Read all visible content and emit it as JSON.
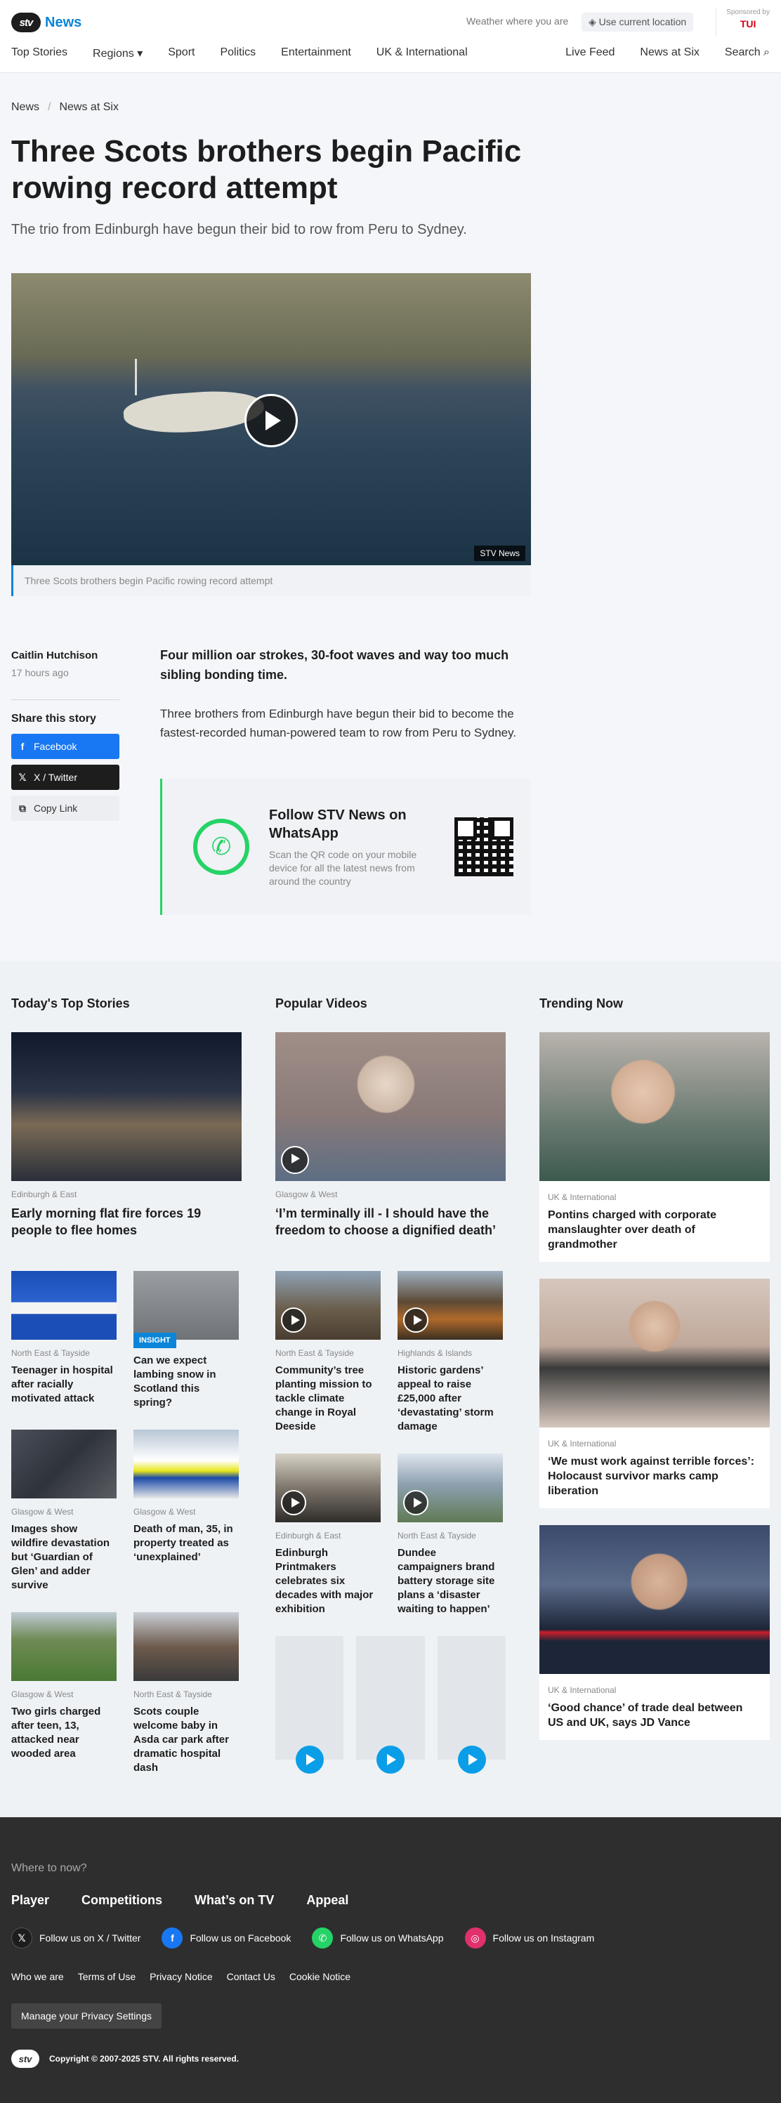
{
  "header": {
    "logo_mark": "stv",
    "logo_news": "News",
    "weather_text": "Weather where you are",
    "location_button": "Use current location",
    "sponsor_text": "Sponsored by",
    "sponsor_brand": "TUI",
    "nav_left": [
      "Top Stories",
      "Regions",
      "Sport",
      "Politics",
      "Entertainment",
      "UK & International"
    ],
    "nav_right": [
      "Live Feed",
      "News at Six",
      "Search"
    ]
  },
  "breadcrumb": [
    "News",
    "News at Six"
  ],
  "article": {
    "title": "Three Scots brothers begin Pacific rowing record attempt",
    "subtitle": "The trio from Edinburgh have begun their bid to row from Peru to Sydney.",
    "video_badge": "STV News",
    "video_caption": "Three Scots brothers begin Pacific rowing record attempt",
    "author": "Caitlin Hutchison",
    "time": "17 hours ago",
    "share_title": "Share this story",
    "share_buttons": [
      "Facebook",
      "X / Twitter",
      "Copy Link"
    ],
    "lead": "Four million oar strokes, 30-foot waves and way too much sibling bonding time.",
    "paragraph": "Three brothers from Edinburgh have begun their bid to become the fastest-recorded human-powered team to row from Peru to Sydney.",
    "whatsapp_title": "Follow STV News on WhatsApp",
    "whatsapp_text": "Scan the QR code on your mobile device for all the latest news from around the country"
  },
  "top_stories": {
    "heading": "Today's Top Stories",
    "main": {
      "category": "Edinburgh & East",
      "title": "Early morning flat fire forces 19 people to flee homes"
    },
    "items": [
      {
        "category": "North East & Tayside",
        "title": "Teenager in hospital after racially motivated attack"
      },
      {
        "badge": "INSIGHT",
        "title": "Can we expect lambing snow in Scotland this spring?"
      },
      {
        "category": "Glasgow & West",
        "title": "Images show wildfire devastation but ‘Guardian of Glen’ and adder survive"
      },
      {
        "category": "Glasgow & West",
        "title": "Death of man, 35, in property treated as ‘unexplained’"
      },
      {
        "category": "Glasgow & West",
        "title": "Two girls charged after teen, 13, attacked near wooded area"
      },
      {
        "category": "North East & Tayside",
        "title": "Scots couple welcome baby in Asda car park after dramatic hospital dash"
      }
    ]
  },
  "popular_videos": {
    "heading": "Popular Videos",
    "main": {
      "category": "Glasgow & West",
      "title": "‘I’m terminally ill - I should have the freedom to choose a dignified death’"
    },
    "items": [
      {
        "category": "North East & Tayside",
        "title": "Community’s tree planting mission to tackle climate change in Royal Deeside"
      },
      {
        "category": "Highlands & Islands",
        "title": "Historic gardens’ appeal to raise £25,000 after ‘devastating’ storm damage"
      },
      {
        "category": "Edinburgh & East",
        "title": "Edinburgh Printmakers celebrates six decades with major exhibition"
      },
      {
        "category": "North East & Tayside",
        "title": "Dundee campaigners brand battery storage site plans a ‘disaster waiting to happen’"
      }
    ]
  },
  "trending": {
    "heading": "Trending Now",
    "items": [
      {
        "category": "UK & International",
        "title": "Pontins charged with corporate manslaughter over death of grandmother"
      },
      {
        "category": "UK & International",
        "title": "‘We must work against terrible forces’: Holocaust survivor marks camp liberation"
      },
      {
        "category": "UK & International",
        "title": "‘Good chance’ of trade deal between US and UK, says JD Vance"
      }
    ]
  },
  "footer": {
    "where_to": "Where to now?",
    "links": [
      "Player",
      "Competitions",
      "What’s on TV",
      "Appeal"
    ],
    "social": [
      "Follow us on X / Twitter",
      "Follow us on Facebook",
      "Follow us on WhatsApp",
      "Follow us on Instagram"
    ],
    "legal": [
      "Who we are",
      "Terms of Use",
      "Privacy Notice",
      "Contact Us",
      "Cookie Notice"
    ],
    "privacy_button": "Manage your Privacy Settings",
    "copyright": "Copyright © 2007-2025 STV. All rights reserved."
  },
  "colors": {
    "accent": "#0a85d9",
    "facebook": "#1877f2",
    "whatsapp": "#25d366",
    "footer_bg": "#2e2e2e"
  }
}
